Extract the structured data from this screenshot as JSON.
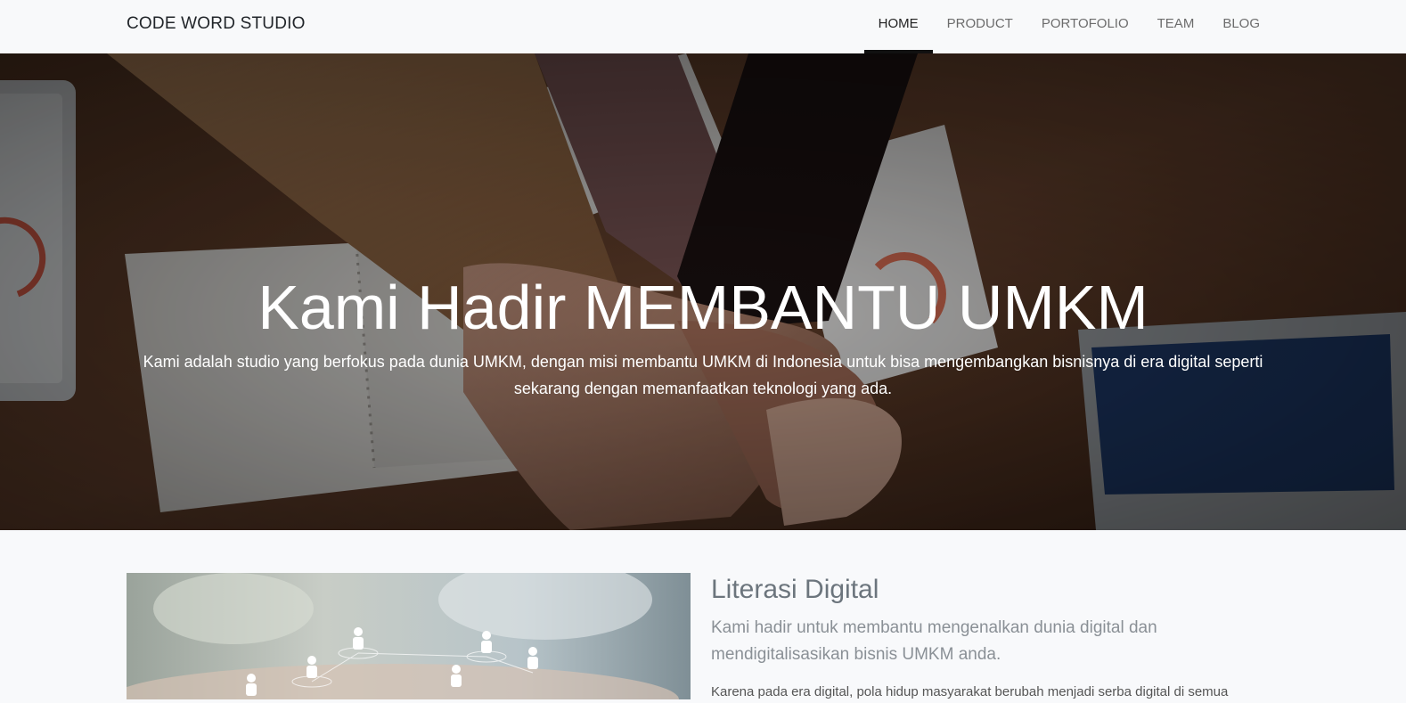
{
  "navbar": {
    "brand": "CODE WORD STUDIO",
    "items": [
      {
        "label": "HOME",
        "active": true
      },
      {
        "label": "PRODUCT",
        "active": false
      },
      {
        "label": "PORTOFOLIO",
        "active": false
      },
      {
        "label": "TEAM",
        "active": false
      },
      {
        "label": "BLOG",
        "active": false
      }
    ]
  },
  "hero": {
    "title_light": "Kami Hadir ",
    "title_bold": "MEMBANTU UMKM",
    "description": "Kami adalah studio yang berfokus pada dunia UMKM, dengan misi membantu UMKM di Indonesia untuk bisa mengembangkan bisnisnya di era digital seperti sekarang dengan memanfaatkan teknologi yang ada."
  },
  "section": {
    "title": "Literasi Digital",
    "lead": "Kami hadir untuk membantu mengenalkan dunia digital dan mendigitalisasikan bisnis UMKM anda.",
    "body": "Karena pada era digital, pola hidup masyarakat berubah menjadi serba digital di semua"
  },
  "colors": {
    "navbar_bg": "#f8f9fa",
    "active_indicator": "#111111",
    "page_bg": "#f8f9fb",
    "heading": "#6c757d"
  }
}
